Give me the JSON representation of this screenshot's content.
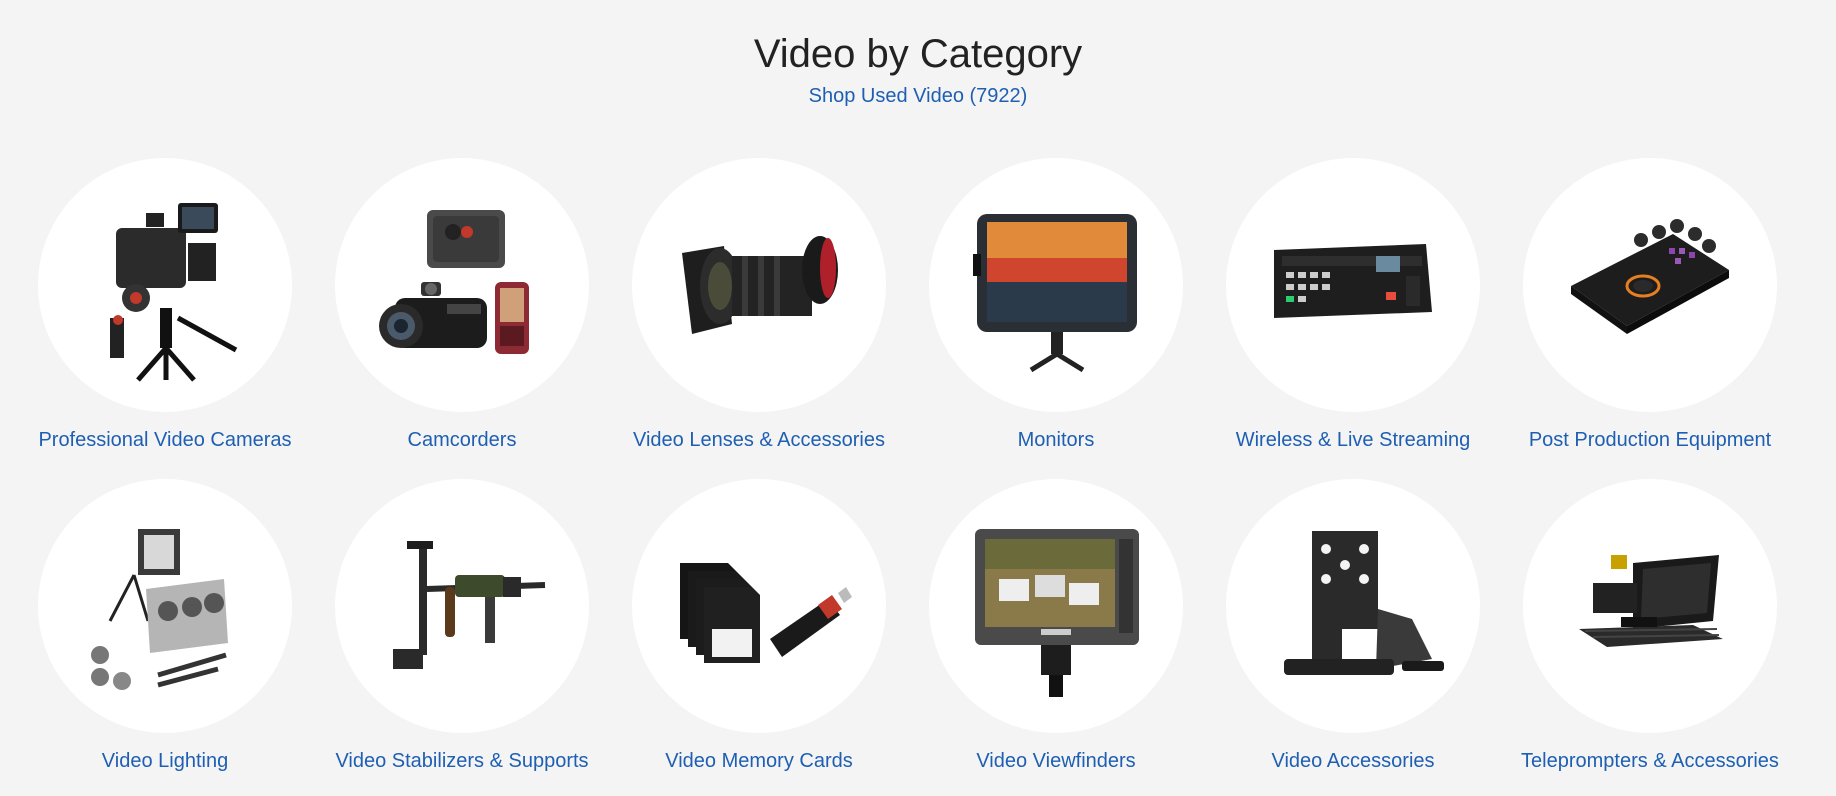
{
  "header": {
    "title": "Video by Category",
    "shop_link": "Shop Used Video (7922)"
  },
  "colors": {
    "background": "#f4f4f4",
    "link": "#1e5fb3",
    "title": "#222222",
    "circle": "#ffffff"
  },
  "categories": [
    {
      "label": "Professional Video Cameras",
      "icon": "cinema-camera-rig-icon"
    },
    {
      "label": "Camcorders",
      "icon": "camcorder-icon"
    },
    {
      "label": "Video Lenses & Accessories",
      "icon": "cine-lens-icon"
    },
    {
      "label": "Monitors",
      "icon": "field-monitor-icon"
    },
    {
      "label": "Wireless & Live Streaming",
      "icon": "video-switcher-icon"
    },
    {
      "label": "Post Production Equipment",
      "icon": "editing-console-icon"
    },
    {
      "label": "Video Lighting",
      "icon": "lighting-kit-icon"
    },
    {
      "label": "Video Stabilizers & Supports",
      "icon": "stabilizer-icon"
    },
    {
      "label": "Video Memory Cards",
      "icon": "memory-card-icon"
    },
    {
      "label": "Video Viewfinders",
      "icon": "viewfinder-monitor-icon"
    },
    {
      "label": "Video Accessories",
      "icon": "mounting-bracket-icon"
    },
    {
      "label": "Teleprompters & Accessories",
      "icon": "teleprompter-icon"
    }
  ]
}
